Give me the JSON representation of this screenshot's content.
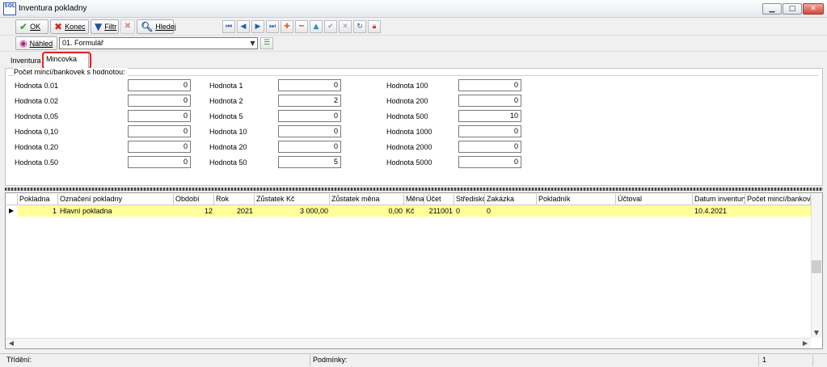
{
  "window": {
    "title": "Inventura pokladny",
    "icon_text": "SOL",
    "buttons": [
      "minimize-icon",
      "maximize-icon",
      "close-icon"
    ]
  },
  "toolbar": {
    "ok_label": "OK",
    "konec_label": "Konec",
    "filtr_label": "Filtr",
    "hledej_label": "Hledej",
    "nav_icons": [
      "first-record-icon",
      "previous-record-icon",
      "next-record-icon",
      "last-record-icon",
      "add-record-icon",
      "delete-record-icon",
      "up-icon",
      "confirm-icon",
      "cancel-icon",
      "refresh-icon",
      "lock-icon"
    ]
  },
  "view": {
    "nahled_label": "Náhled",
    "form_selected": "01. Formulář"
  },
  "tabs": [
    {
      "label": "Inventura"
    },
    {
      "label": "Mincovka"
    }
  ],
  "group": {
    "title": "Počet mincí/bankovek s hodnotou:"
  },
  "fields": [
    [
      {
        "label": "Hodnota 0.01",
        "value": "0"
      },
      {
        "label": "Hodnota 1",
        "value": "0"
      },
      {
        "label": "Hodnota 100",
        "value": "0"
      }
    ],
    [
      {
        "label": "Hodnota 0.02",
        "value": "0"
      },
      {
        "label": "Hodnota 2",
        "value": "2"
      },
      {
        "label": "Hodnota 200",
        "value": "0"
      }
    ],
    [
      {
        "label": "Hodnota 0,05",
        "value": "0"
      },
      {
        "label": "Hodnota 5",
        "value": "0"
      },
      {
        "label": "Hodnota 500",
        "value": "10"
      }
    ],
    [
      {
        "label": "Hodnota 0,10",
        "value": "0"
      },
      {
        "label": "Hodnota 10",
        "value": "0"
      },
      {
        "label": "Hodnota 1000",
        "value": "0"
      }
    ],
    [
      {
        "label": "Hodnota 0.20",
        "value": "0"
      },
      {
        "label": "Hodnota 20",
        "value": "0"
      },
      {
        "label": "Hodnota 2000",
        "value": "0"
      }
    ],
    [
      {
        "label": "Hodnota 0.50",
        "value": "0"
      },
      {
        "label": "Hodnota 50",
        "value": "5"
      },
      {
        "label": "Hodnota 5000",
        "value": "0"
      }
    ]
  ],
  "grid": {
    "columns": [
      "Pokladna",
      "Označení pokladny",
      "Období",
      "Rok",
      "Zůstatek Kč",
      "Zůstatek měna",
      "Měna",
      "Účet",
      "Středisko",
      "Zakázka",
      "Pokladník",
      "Účtoval",
      "Datum inventury",
      "Počet mincí/bankove"
    ],
    "rows": [
      [
        "1",
        "Hlavní pokladna",
        "12",
        "2021",
        "3 000,00",
        "0,00",
        "Kč",
        "211001",
        "0",
        "0",
        "",
        "",
        "10.4.2021",
        ""
      ]
    ]
  },
  "status": {
    "trideni_label": "Třídění:",
    "podminky_label": "Podmínky:",
    "count": "1"
  }
}
